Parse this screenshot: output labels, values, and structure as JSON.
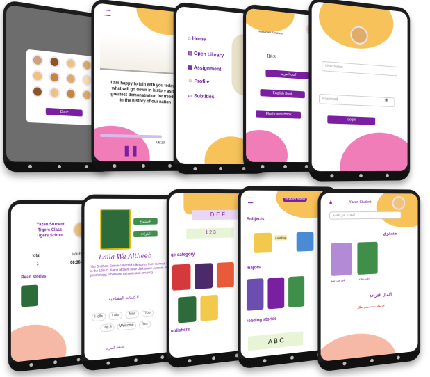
{
  "colors": {
    "purple": "#7b1fa2",
    "yellow": "#f7c25a",
    "pink": "#f07cb8",
    "phone": "#1c1c1e"
  },
  "s1": {
    "done_label": "Done"
  },
  "s2": {
    "story_text": "I am happy to join with you today in what will go down in history as the greatest demonstration for freedom in the history of our nation",
    "time_end": "06:20"
  },
  "s3": {
    "menu": [
      "Home",
      "Open Library",
      "Assignment",
      "Profile",
      "Subtitles"
    ]
  },
  "s4": {
    "user_name": "Mohamed Ebrahem",
    "title_partial": "tles",
    "buttons": [
      "كتب العربية",
      "English Book",
      "Flashcards Book"
    ]
  },
  "s5": {
    "user_field": "User Name",
    "password_field": "Password",
    "login_label": "Login"
  },
  "s6": {
    "student": "Yazen Student",
    "class": "Tigers Class",
    "school": "Tigers School",
    "total_label": "total",
    "total_value": "1",
    "hours_label": "Hours",
    "hours_value": "00:36:41",
    "read_stories": "Read stories"
  },
  "s7": {
    "title": "Laila Wa Altheeb",
    "blurb": "The Brothers Grimm collected folk stories from German households in the 19th C. Some of them have dark under-currents of psychology; others are romantic and amusing.",
    "arabic_heading": "الكلمات المفتاحية",
    "btn1": "الاستماع",
    "btn2": "القراءة",
    "chips": [
      "Hello",
      "Laila",
      "Now",
      "You",
      "Top 3",
      "Welcome",
      "Yes"
    ],
    "footer": "اضغط للمزيد"
  },
  "s8": {
    "banner": "DEF",
    "banner2": "1 2 3",
    "heading": "ge category",
    "sub": "ublishers"
  },
  "s9": {
    "user_name": "student name",
    "subjects": "Subjects",
    "majors": "majors",
    "reading": "reading stories",
    "book_titles": [
      "Lost Dog",
      "Gold",
      "My Lovely Family",
      "Lost Dog",
      "Go Get Luna",
      "Ok Book plants"
    ],
    "abc": "A B C"
  },
  "s10": {
    "user_name": "Yazan Student",
    "search_placeholder": "البحث عن قصة",
    "level": "مستوى",
    "completion": "اكمال القراءة",
    "completion_item": "خريطة شخصيتي بطل",
    "book_labels": [
      "في مدرسة",
      "الأصدقاء"
    ]
  }
}
